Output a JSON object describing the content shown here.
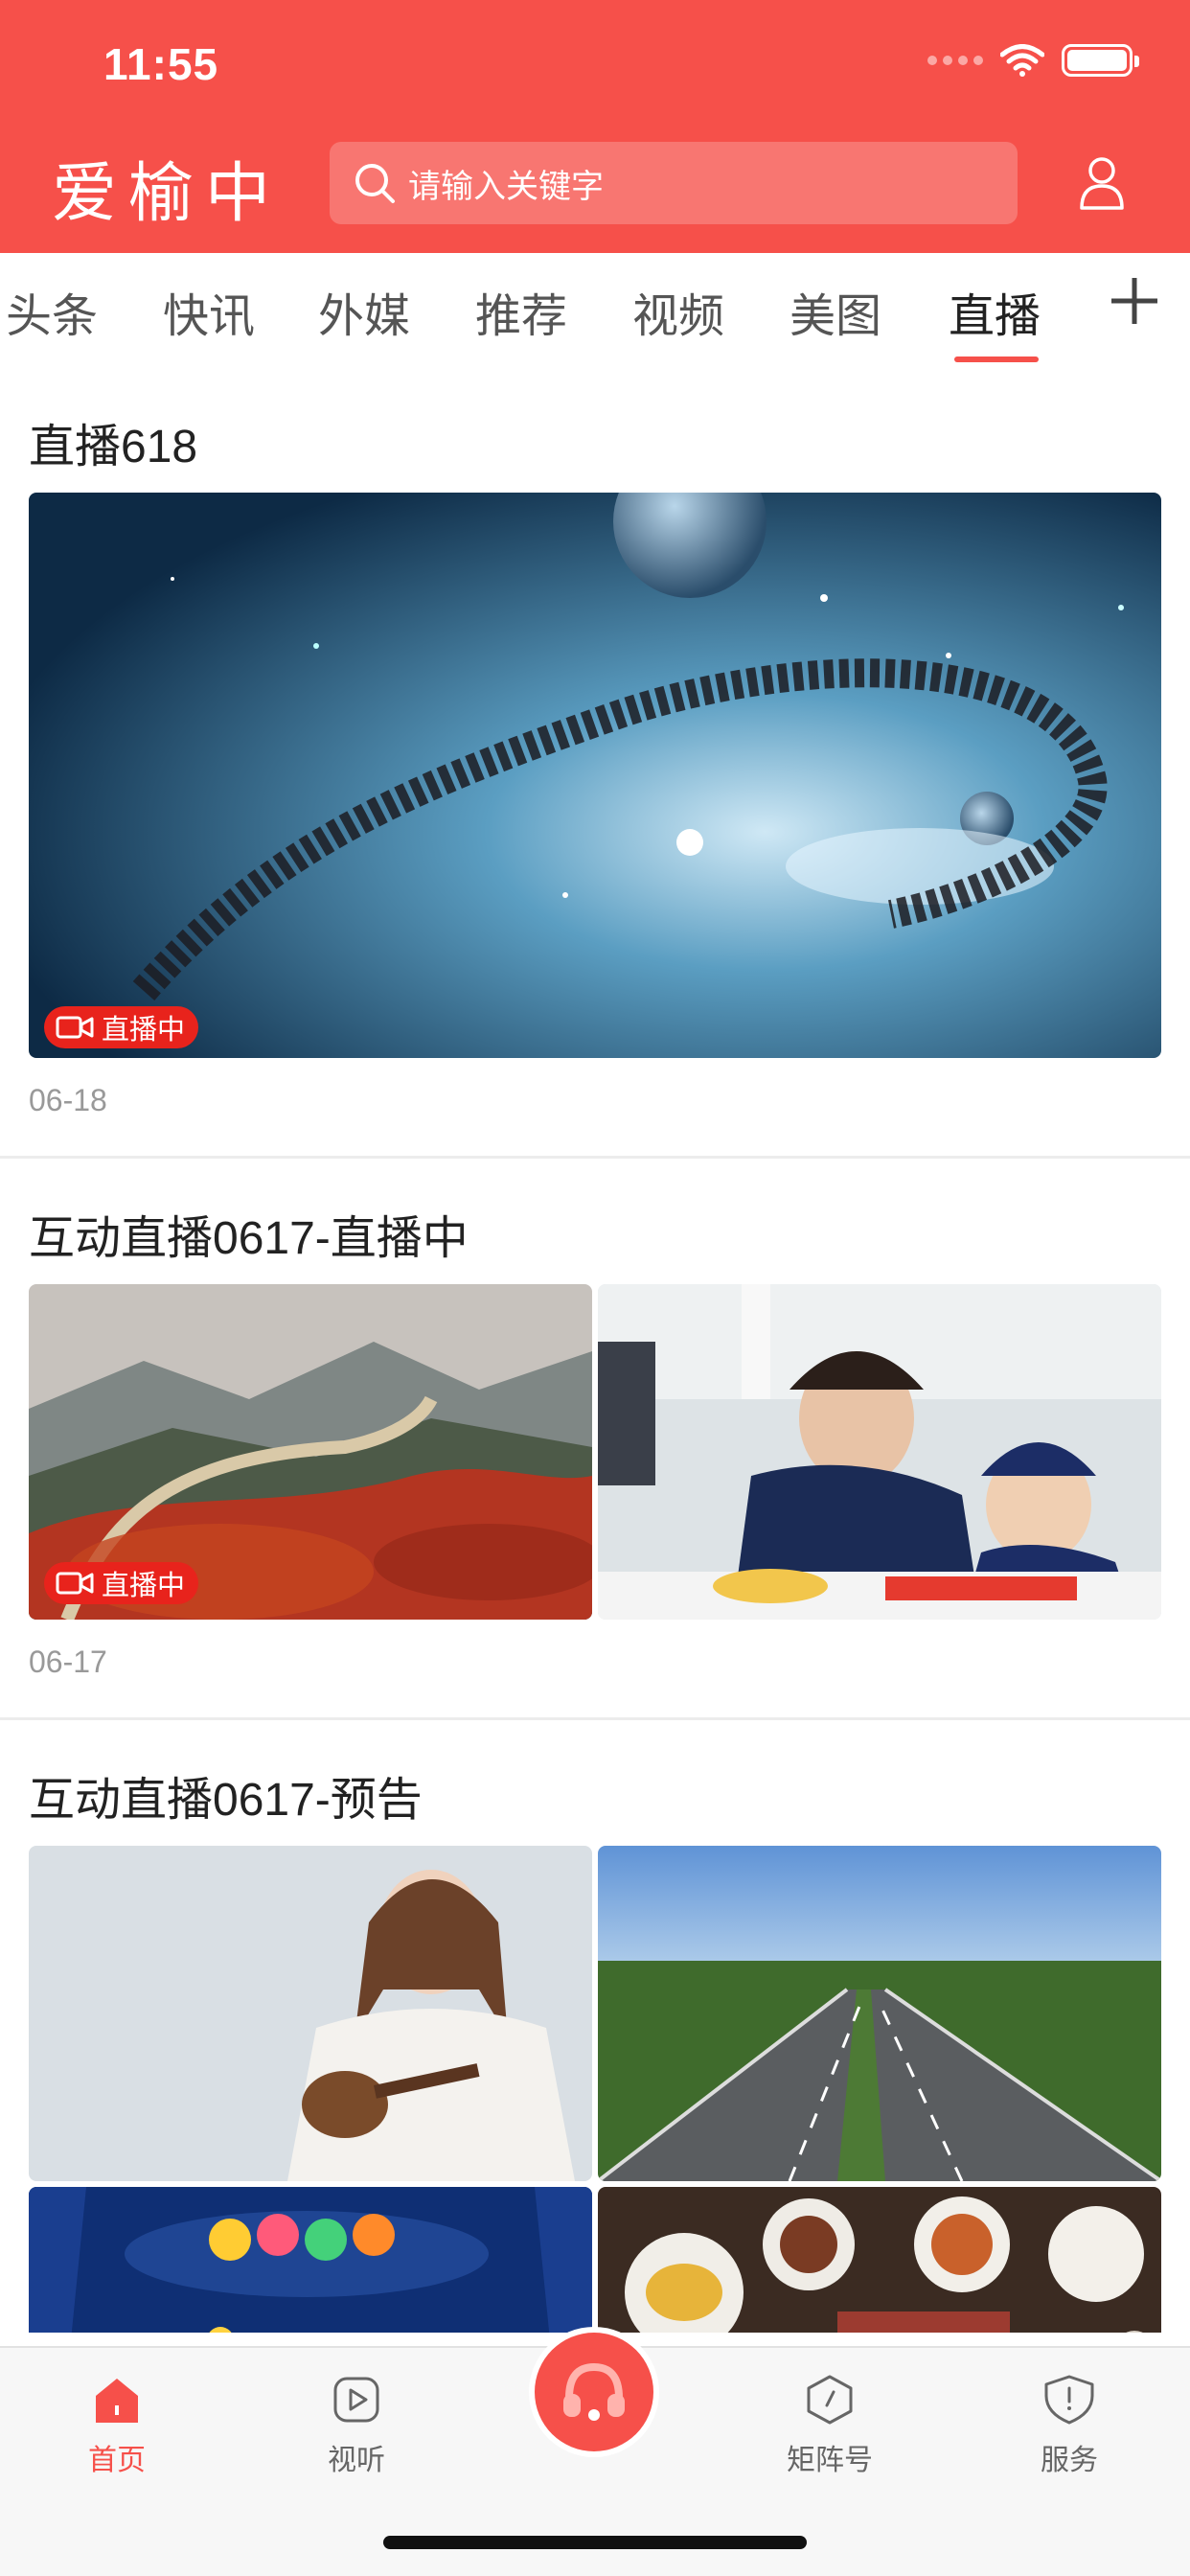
{
  "status_bar": {
    "time": "11:55"
  },
  "header": {
    "brand": "爱榆中",
    "search_placeholder": "请输入关键字",
    "accent_color": "#f6504a"
  },
  "tabs": [
    {
      "label": "头条"
    },
    {
      "label": "快讯"
    },
    {
      "label": "外媒"
    },
    {
      "label": "推荐"
    },
    {
      "label": "视频"
    },
    {
      "label": "美图"
    },
    {
      "label": "直播",
      "active": true
    }
  ],
  "live_badge_label": "直播中",
  "feed": [
    {
      "title": "直播618",
      "date": "06-18",
      "live": true,
      "images": [
        "space-galaxy"
      ]
    },
    {
      "title": "互动直播0617-直播中",
      "date": "06-17",
      "live": true,
      "images": [
        "great-wall-autumn",
        "mother-and-child-cooking"
      ]
    },
    {
      "title": "互动直播0617-预告",
      "images": [
        "woman-with-ukulele",
        "highway",
        "seaside-city-theatre",
        "food-table"
      ]
    }
  ],
  "bottom_nav": [
    {
      "label": "首页",
      "icon": "home-icon",
      "active": true
    },
    {
      "label": "视听",
      "icon": "play-icon"
    },
    {
      "label": "",
      "icon": "headset-icon"
    },
    {
      "label": "矩阵号",
      "icon": "compass-icon"
    },
    {
      "label": "服务",
      "icon": "service-icon"
    }
  ]
}
